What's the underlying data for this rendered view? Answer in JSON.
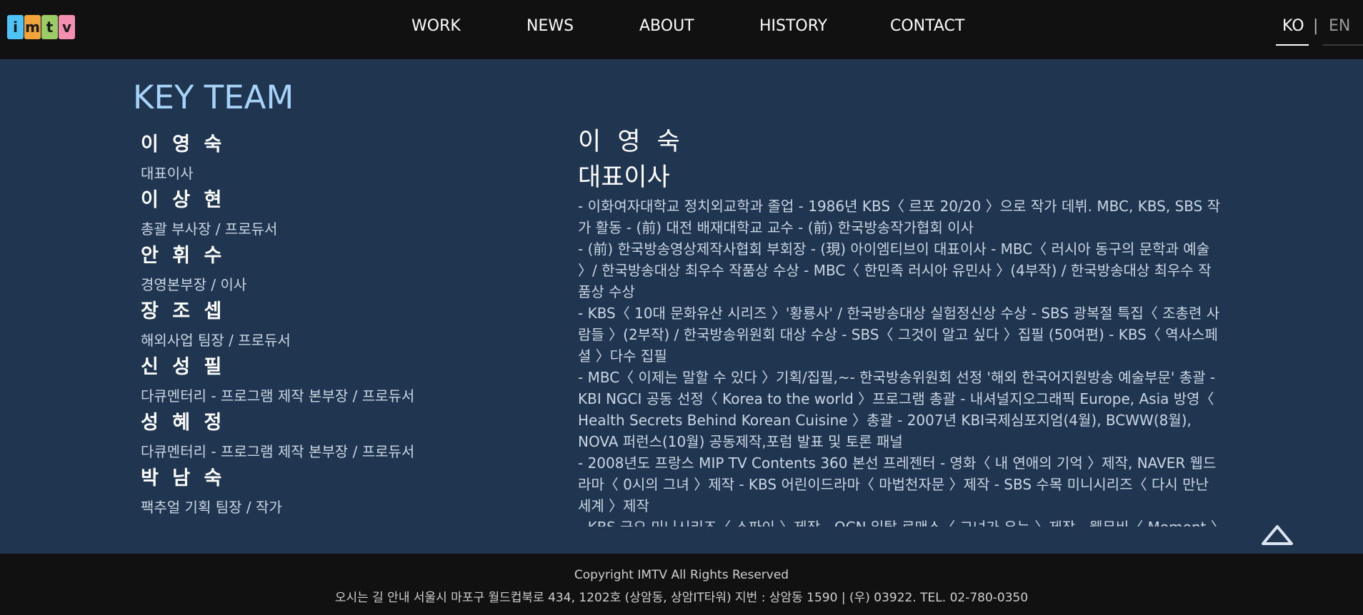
{
  "header": {
    "logo_letters": [
      "i",
      "m",
      "t",
      "v"
    ],
    "logo_colors": [
      "#4fc3f7",
      "#f2a33a",
      "#9ccc65",
      "#f48fb1"
    ],
    "nav": [
      "WORK",
      "NEWS",
      "ABOUT",
      "HISTORY",
      "CONTACT"
    ],
    "lang": {
      "ko": "KO",
      "separator": "|",
      "en": "EN"
    }
  },
  "page": {
    "title": "KEY TEAM"
  },
  "team": [
    {
      "name": "이 영 숙",
      "role": "대표이사"
    },
    {
      "name": "이 상 현",
      "role": "총괄 부사장 / 프로듀서"
    },
    {
      "name": "안 휘 수",
      "role": "경영본부장 / 이사"
    },
    {
      "name": "장 조 셉",
      "role": "해외사업 팀장 / 프로듀서"
    },
    {
      "name": "신 성 필",
      "role": "다큐멘터리 - 프로그램 제작 본부장 / 프로듀서"
    },
    {
      "name": "성 혜 정",
      "role": "다큐멘터리 - 프로그램 제작 본부장 / 프로듀서"
    },
    {
      "name": "박 남 숙",
      "role": "팩추얼 기획 팀장 / 작가"
    }
  ],
  "detail": {
    "name": "이 영 숙",
    "role": "대표이사",
    "bio": [
      "- 이화여자대학교 정치외교학과 졸업 - 1986년 KBS〈 르포 20/20 〉으로 작가 데뷔. MBC, KBS, SBS 작가 활동 - (前) 대전 배재대학교 교수 - (前) 한국방송작가협회 이사",
      "- (前) 한국방송영상제작사협회 부회장 - (現) 아이엠티브이 대표이사 - MBC〈 러시아 동구의 문학과 예술 〉/ 한국방송대상 최우수 작품상 수상 - MBC〈 한민족 러시아 유민사 〉(4부작) / 한국방송대상 최우수 작품상 수상",
      "- KBS〈 10대 문화유산 시리즈 〉'황룡사' / 한국방송대상 실험정신상 수상 - SBS 광복절 특집〈 조총련 사람들 〉(2부작) / 한국방송위원회 대상 수상 - SBS〈 그것이 알고 싶다 〉집필 (50여편) - KBS〈 역사스페셜 〉다수 집필",
      "- MBC〈 이제는 말할 수 있다 〉기획/집필,~- 한국방송위원회 선정 '해외 한국어지원방송 예술부문' 총괄 - KBI NGCI 공동 선정〈 Korea to the world 〉프로그램 총괄 - 내셔널지오그래픽 Europe, Asia 방영〈 Health Secrets Behind Korean Cuisine 〉총괄 - 2007년 KBI국제심포지엄(4월), BCWW(8월), NOVA 퍼런스(10월) 공동제작,포럼 발표 및 토론 패널",
      "- 2008년도 프랑스 MIP TV Contents 360 본선 프레젠터 - 영화〈 내 연애의 기억 〉제작, NAVER 웹드라마〈 0시의 그녀 〉제작 - KBS 어린이드라마〈 마법천자문 〉제작 - SBS 수목 미니시리즈〈 다시 만난 세계 〉제작",
      "- KBS 금요 미니시리즈〈 스파이 〉제작 - OCN 일탈 로맨스〈 그녀가 우는 〉제작 - 웹무비〈 Moment 〉"
    ]
  },
  "footer": {
    "copyright": "Copyright IMTV All Rights Reserved",
    "address": "오시는 길 안내 서울시 마포구 월드컵북로 434, 1202호 (상암동, 상암IT타워) 지번 : 상암동 1590 | (우) 03922. TEL. 02-780-0350"
  },
  "colors": {
    "content_bg": "#1f3550",
    "bar_bg": "#111111",
    "title_accent": "#a7d3f8"
  },
  "icons": {
    "scroll_top": "chevron-up-icon"
  }
}
